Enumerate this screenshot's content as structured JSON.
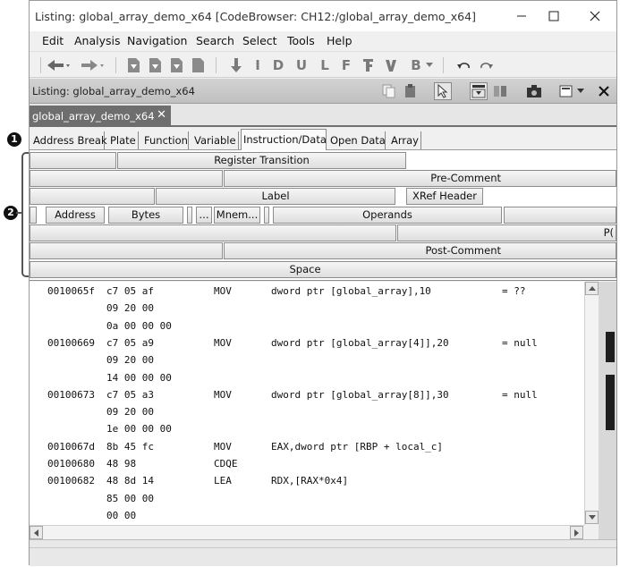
{
  "window": {
    "title": "Listing:  global_array_demo_x64 [CodeBrowser: CH12:/global_array_demo_x64]"
  },
  "menubar": {
    "items": [
      "Edit",
      "Analysis",
      "Navigation",
      "Search",
      "Select",
      "Tools",
      "Help"
    ]
  },
  "toolbar": {
    "letter_buttons": [
      "I",
      "D",
      "U",
      "L",
      "F",
      "B"
    ]
  },
  "listing_header": {
    "title": "Listing:  global_array_demo_x64"
  },
  "tab": {
    "label": "global_array_demo_x64"
  },
  "field_tabs": [
    "Address Break",
    "Plate",
    "Function",
    "Variable",
    "Instruction/Data",
    "Open Data",
    "Array"
  ],
  "format_grid": {
    "register_transition": "Register Transition",
    "pre_comment": "Pre-Comment",
    "label": "Label",
    "xref_header": "XRef Header",
    "address": "Address",
    "bytes": "Bytes",
    "ellipsis": "...",
    "mnemonic": "Mnem...",
    "operands": "Operands",
    "post_comment": "Post-Comment",
    "space": "Space",
    "truncated_p": "P("
  },
  "code_lines": [
    {
      "addr": "0010065f",
      "bytes": "c7 05 af",
      "mnem": "MOV",
      "ops": "dword ptr [global_array],10",
      "comment": "= ??"
    },
    {
      "addr": "",
      "bytes": "09 20 00",
      "mnem": "",
      "ops": "",
      "comment": ""
    },
    {
      "addr": "",
      "bytes": "0a 00 00 00",
      "mnem": "",
      "ops": "",
      "comment": ""
    },
    {
      "addr": "00100669",
      "bytes": "c7 05 a9",
      "mnem": "MOV",
      "ops": "dword ptr [global_array[4]],20",
      "comment": "= null"
    },
    {
      "addr": "",
      "bytes": "09 20 00",
      "mnem": "",
      "ops": "",
      "comment": ""
    },
    {
      "addr": "",
      "bytes": "14 00 00 00",
      "mnem": "",
      "ops": "",
      "comment": ""
    },
    {
      "addr": "00100673",
      "bytes": "c7 05 a3",
      "mnem": "MOV",
      "ops": "dword ptr [global_array[8]],30",
      "comment": "= null"
    },
    {
      "addr": "",
      "bytes": "09 20 00",
      "mnem": "",
      "ops": "",
      "comment": ""
    },
    {
      "addr": "",
      "bytes": "1e 00 00 00",
      "mnem": "",
      "ops": "",
      "comment": ""
    },
    {
      "addr": "0010067d",
      "bytes": "8b 45 fc",
      "mnem": "MOV",
      "ops": "EAX,dword ptr [RBP + local_c]",
      "comment": ""
    },
    {
      "addr": "00100680",
      "bytes": "48 98",
      "mnem": "CDQE",
      "ops": "",
      "comment": ""
    },
    {
      "addr": "00100682",
      "bytes": "48 8d 14",
      "mnem": "LEA",
      "ops": "RDX,[RAX*0x4]",
      "comment": ""
    },
    {
      "addr": "",
      "bytes": "85 00 00",
      "mnem": "",
      "ops": "",
      "comment": ""
    },
    {
      "addr": "",
      "bytes": "00 00",
      "mnem": "",
      "ops": "",
      "comment": ""
    }
  ],
  "callouts": {
    "one": "1",
    "two": "2"
  }
}
